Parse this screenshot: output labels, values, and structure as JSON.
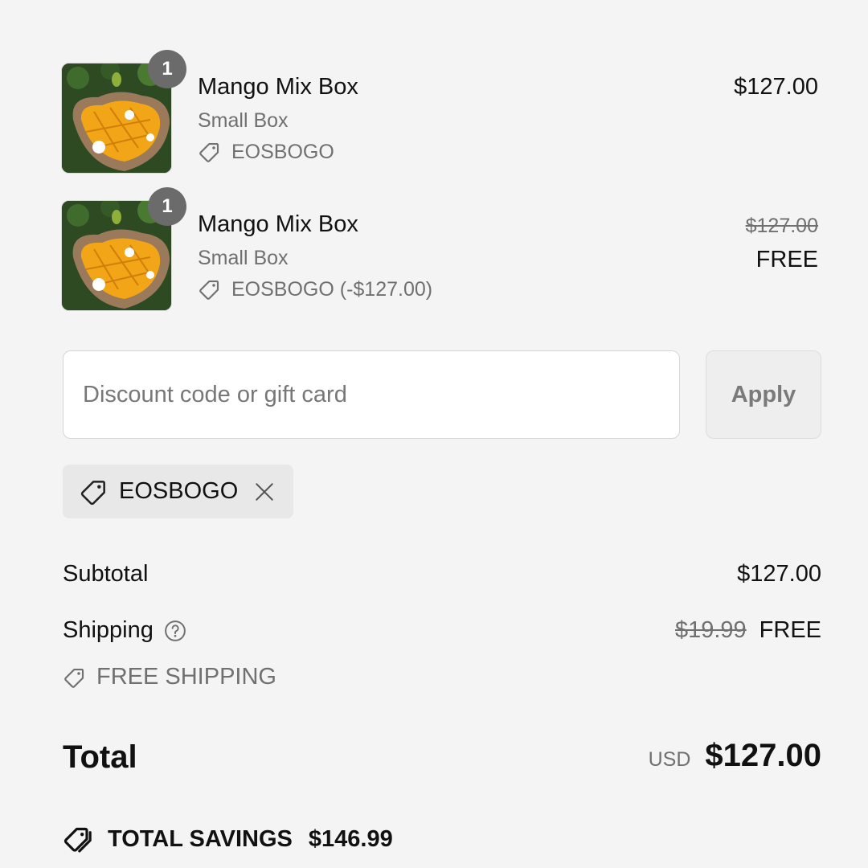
{
  "line_items": [
    {
      "quantity": "1",
      "name": "Mango Mix Box",
      "variant": "Small Box",
      "discount": "EOSBOGO",
      "price": "$127.00",
      "image_icon": "mango-photo"
    },
    {
      "quantity": "1",
      "name": "Mango Mix Box",
      "variant": "Small Box",
      "discount": "EOSBOGO (-$127.00)",
      "original_price": "$127.00",
      "price": "FREE",
      "image_icon": "mango-photo"
    }
  ],
  "discount_form": {
    "placeholder": "Discount code or gift card",
    "value": "",
    "apply_label": "Apply"
  },
  "applied_code": {
    "label": "EOSBOGO",
    "icon": "tag-icon",
    "remove_icon": "close-icon"
  },
  "summary": {
    "subtotal_label": "Subtotal",
    "subtotal_value": "$127.00",
    "shipping_label": "Shipping",
    "shipping_help_icon": "question-circle-icon",
    "shipping_original": "$19.99",
    "shipping_value": "FREE",
    "shipping_discount": "FREE SHIPPING",
    "total_label": "Total",
    "currency": "USD",
    "total_value": "$127.00",
    "savings_label": "TOTAL SAVINGS",
    "savings_value": "$146.99"
  },
  "colors": {
    "background": "#f4f4f4",
    "muted_text": "#707070",
    "badge": "#6b6b6b",
    "chip": "#e8e8e8"
  }
}
